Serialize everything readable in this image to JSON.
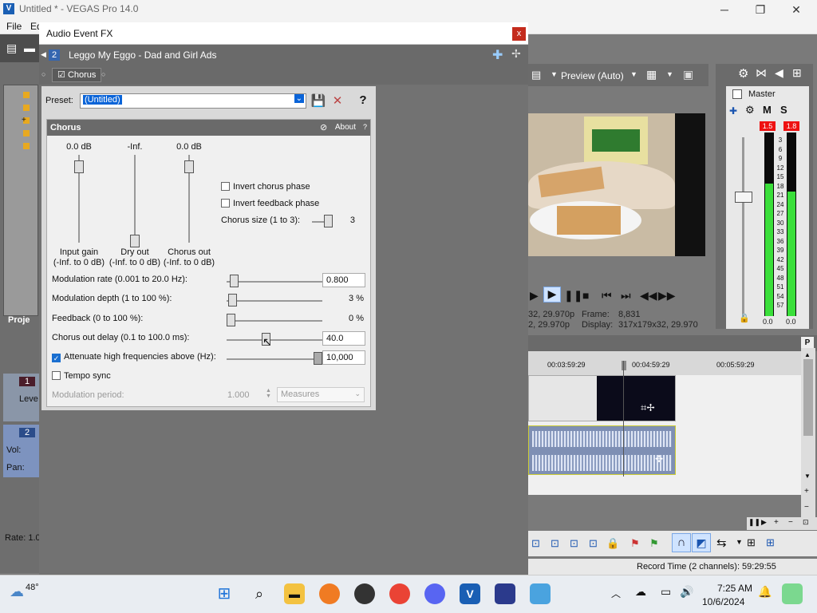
{
  "app": {
    "window_title": "Untitled * - VEGAS Pro 14.0",
    "menu": [
      "File",
      "Ed"
    ],
    "logo_letter": "V",
    "controls": {
      "minimize": "─",
      "maximize": "❐",
      "close": "✕"
    }
  },
  "left_panel": {
    "project_tab": "Proje",
    "tracks": [
      {
        "number": "1",
        "labels": [
          "Leve"
        ]
      },
      {
        "number": "2",
        "labels": [
          "Vol:",
          "Pan:"
        ]
      }
    ],
    "rate_label": "Rate: 1.0"
  },
  "preview": {
    "mode_label": "Preview (Auto)",
    "info_line1_left": "32, 29.970p",
    "info_line1_right_label": "Frame:",
    "info_line1_right_value": "8,831",
    "info_line2_left": "2, 29.970p",
    "info_line2_right_label": "Display:",
    "info_line2_right_value": "317x179x32, 29.970"
  },
  "master": {
    "title": "Master",
    "m_label": "M",
    "s_label": "S",
    "peak_left": "1.5",
    "peak_right": "1.8",
    "scale": [
      "3",
      "6",
      "9",
      "12",
      "15",
      "18",
      "21",
      "24",
      "27",
      "30",
      "33",
      "36",
      "39",
      "42",
      "45",
      "48",
      "51",
      "54",
      "57"
    ],
    "bottom_left": "0.0",
    "bottom_right": "0.0",
    "level_left": 0.72,
    "level_right": 0.68
  },
  "timeline": {
    "ruler_marks": [
      "00:03:59:29",
      "00:04:59:29",
      "00:05:59:29"
    ],
    "status": "Record Time (2 channels): 59:29:55"
  },
  "fx_dialog": {
    "title": "Audio Event FX",
    "close": "x",
    "track_number": "2",
    "event_name": "Leggo My Eggo - Dad and Girl Ads",
    "chain_item": "Chorus",
    "preset_label": "Preset:",
    "preset_value": "(Untitled)",
    "help": "?",
    "plugin": {
      "name": "Chorus",
      "about": "About",
      "about_q": "?",
      "sliders": [
        {
          "value": "0.0 dB",
          "caption1": "Input gain",
          "caption2": "(-Inf. to 0 dB)",
          "level": 0.93
        },
        {
          "value": "-Inf.",
          "caption1": "Dry out",
          "caption2": "(-Inf. to 0 dB)",
          "level": 0.0
        },
        {
          "value": "0.0 dB",
          "caption1": "Chorus out",
          "caption2": "(-Inf. to 0 dB)",
          "level": 0.93
        }
      ],
      "invert_chorus": {
        "label": "Invert chorus phase",
        "checked": false
      },
      "invert_feedback": {
        "label": "Invert feedback phase",
        "checked": false
      },
      "chorus_size": {
        "label": "Chorus size (1 to 3):",
        "value": "3",
        "level": 1.0
      },
      "modulation_rate": {
        "label": "Modulation rate (0.001 to 20.0 Hz):",
        "value": "0.800",
        "level": 0.04
      },
      "modulation_depth": {
        "label": "Modulation depth (1 to 100 %):",
        "value": "3 %",
        "level": 0.02
      },
      "feedback": {
        "label": "Feedback (0 to 100 %):",
        "value": "0 %",
        "level": 0.0
      },
      "chorus_out_delay": {
        "label": "Chorus out delay (0.1 to 100.0 ms):",
        "value": "40.0",
        "level": 0.4
      },
      "attenuate": {
        "label": "Attenuate high frequencies above (Hz):",
        "value": "10,000",
        "checked": true,
        "level": 1.0
      },
      "tempo_sync": {
        "label": "Tempo sync",
        "checked": false
      },
      "modulation_period": {
        "label": "Modulation period:",
        "value": "1.000",
        "unit": "Measures"
      }
    }
  },
  "taskbar": {
    "weather": "48°",
    "time": "7:25 AM",
    "date": "10/6/2024"
  }
}
